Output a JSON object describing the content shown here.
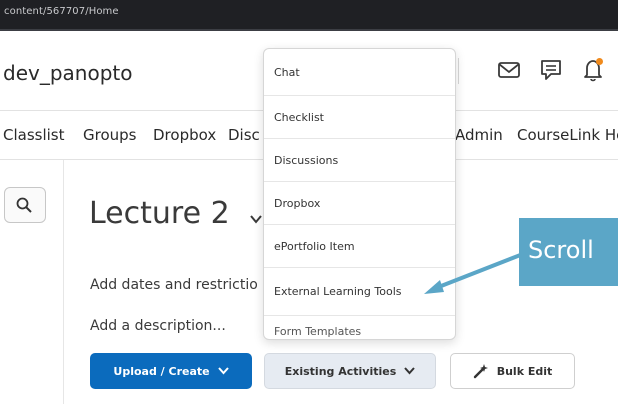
{
  "browser": {
    "url": "content/567707/Home"
  },
  "header": {
    "site_title": "dev_panopto",
    "icons": [
      "mail-icon",
      "chat-bubble-icon",
      "bell-icon"
    ],
    "notification_dot_color": "#f08a1c"
  },
  "nav": {
    "items": [
      {
        "label": "Classlist"
      },
      {
        "label": "Groups"
      },
      {
        "label": "Dropbox"
      },
      {
        "label": "Disc"
      },
      {
        "label": "Admin"
      },
      {
        "label": "CourseLink He"
      }
    ]
  },
  "sidebar": {
    "search_icon": "search-icon"
  },
  "main": {
    "title": "Lecture 2",
    "dates_text": "Add dates and restrictio",
    "description_text": "Add a description...",
    "buttons": {
      "upload_create": "Upload / Create",
      "existing_activities": "Existing Activities",
      "bulk_edit": "Bulk Edit"
    },
    "primary_color": "#0b6bbd"
  },
  "dropdown": {
    "items": [
      {
        "label": "Chat"
      },
      {
        "label": "Checklist"
      },
      {
        "label": "Discussions"
      },
      {
        "label": "Dropbox"
      },
      {
        "label": "ePortfolio Item"
      },
      {
        "label": "External Learning Tools"
      }
    ],
    "partial_item": "Form Templates"
  },
  "annotation": {
    "label": "Scroll",
    "color": "#5ba6c7"
  }
}
